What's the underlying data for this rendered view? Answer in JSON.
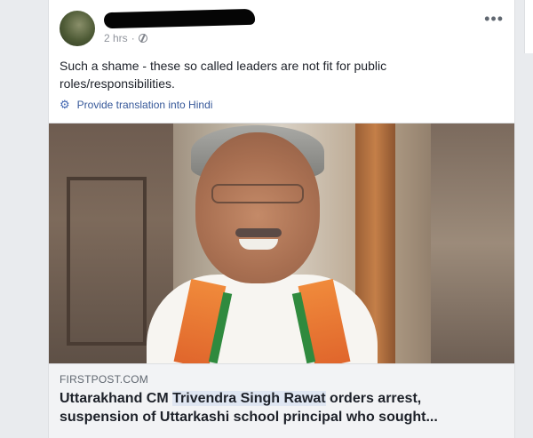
{
  "post": {
    "time": "2 hrs",
    "privacy_icon": "globe-icon",
    "text_line1": "Such a shame - these so called leaders are not fit for public",
    "text_line2": "roles/responsibilities.",
    "translate_label": "Provide translation into Hindi",
    "more_icon": "ellipsis-icon"
  },
  "link_preview": {
    "domain": "FIRSTPOST.COM",
    "headline_part1": "Uttarakhand CM ",
    "headline_highlight": "Trivendra Singh Rawat",
    "headline_part2": " orders arrest,",
    "headline_line2": "suspension of Uttarkashi school principal who sought..."
  },
  "colors": {
    "link_blue": "#365899",
    "caption_bg": "#f2f3f5",
    "highlight_bg": "#dfe6f2"
  }
}
